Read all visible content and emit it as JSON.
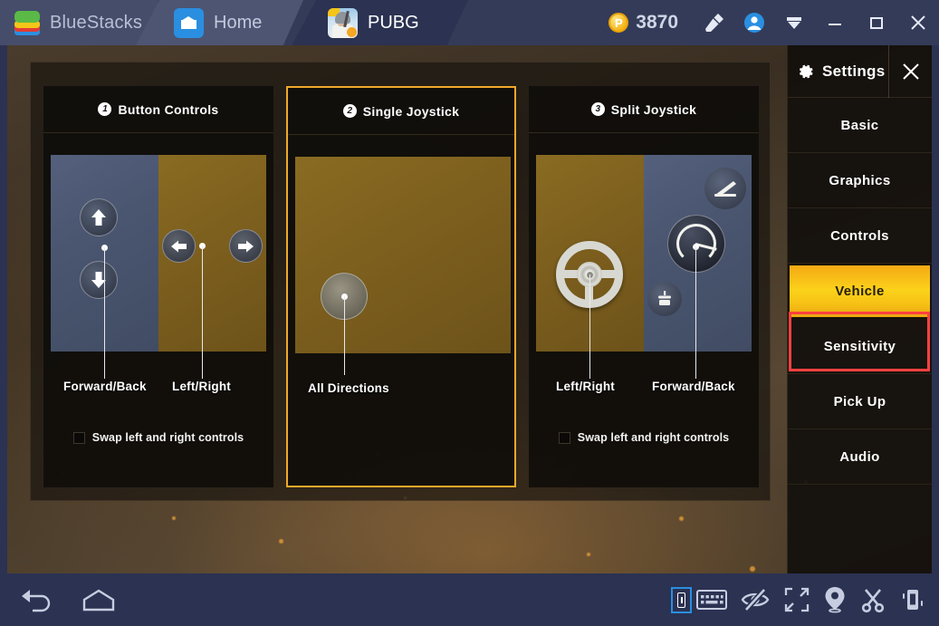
{
  "titlebar": {
    "brand": "BlueStacks",
    "brand_logo_icon": "bluestacks-logo",
    "tabs": [
      {
        "label": "Home",
        "icon": "home-icon",
        "active": false
      },
      {
        "label": "PUBG",
        "icon": "pubg-app-icon",
        "active": true
      }
    ],
    "coin": {
      "icon": "points-coin-icon",
      "symbol": "P",
      "count": "3870"
    },
    "icons": [
      {
        "name": "brush-icon"
      },
      {
        "name": "account-avatar-icon"
      },
      {
        "name": "chevron-down-icon"
      }
    ],
    "window_controls": [
      {
        "name": "minimize-button",
        "glyph": "—"
      },
      {
        "name": "maximize-button",
        "glyph": "□"
      },
      {
        "name": "close-button",
        "glyph": "✕"
      }
    ]
  },
  "controls_screen": {
    "options": [
      {
        "number": "1",
        "title": "Button Controls",
        "captions": [
          "Forward/Back",
          "Left/Right"
        ],
        "swap_label": "Swap left and right controls",
        "swap_checked": false,
        "selected": false
      },
      {
        "number": "2",
        "title": "Single Joystick",
        "captions": [
          "All Directions"
        ],
        "swap_label": "",
        "swap_checked": false,
        "selected": true
      },
      {
        "number": "3",
        "title": "Split Joystick",
        "captions": [
          "Left/Right",
          "Forward/Back"
        ],
        "swap_label": "Swap left and right controls",
        "swap_checked": false,
        "selected": false
      }
    ]
  },
  "settings": {
    "title": "Settings",
    "gear_icon": "gear-icon",
    "close_icon": "close-icon",
    "items": [
      {
        "label": "Basic",
        "active": false
      },
      {
        "label": "Graphics",
        "active": false
      },
      {
        "label": "Controls",
        "active": false
      },
      {
        "label": "Vehicle",
        "active": true
      },
      {
        "label": "Sensitivity",
        "active": false
      },
      {
        "label": "Pick Up",
        "active": false
      },
      {
        "label": "Audio",
        "active": false
      }
    ],
    "highlight_color": "#ff4040",
    "active_color": "#fbd21a"
  },
  "bottombar": {
    "left_icons": [
      {
        "name": "back-icon"
      },
      {
        "name": "home-icon"
      }
    ],
    "right_icons": [
      {
        "name": "game-controls-icon"
      },
      {
        "name": "keyboard-icon"
      },
      {
        "name": "hide-controls-icon"
      },
      {
        "name": "fullscreen-icon"
      },
      {
        "name": "location-icon"
      },
      {
        "name": "screenshot-scissors-icon"
      },
      {
        "name": "shake-device-icon"
      }
    ]
  }
}
